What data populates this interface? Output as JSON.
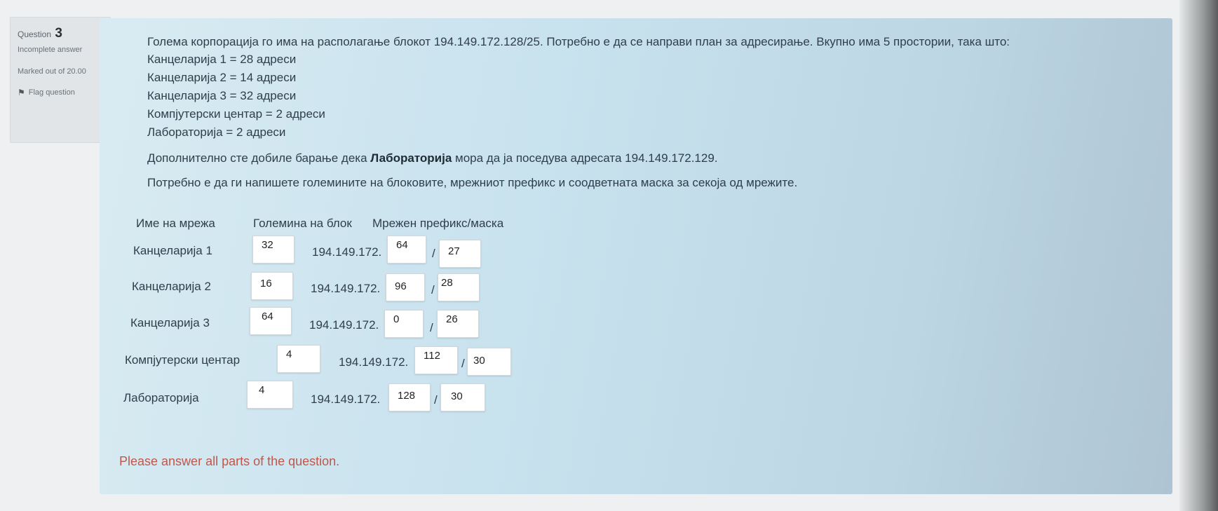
{
  "question": {
    "label": "Question",
    "number": "3",
    "state": "Incomplete answer",
    "grade": "Marked out of 20.00",
    "flag_label": "Flag question",
    "flag_icon": "flag-icon"
  },
  "text": {
    "intro": "Голема корпорација го има на располагање блокот 194.149.172.128/25. Потребно е да се направи план за адресирање. Вкупно има 5 простории, така што:",
    "requirements": [
      "Канцеларија 1 = 28 адреси",
      "Канцеларија 2 = 14 адреси",
      "Канцеларија 3 = 32 адреси",
      "Компјутерски центар = 2 адреси",
      "Лабораторија = 2 адреси"
    ],
    "extra_before": "Дополнително сте добиле барање дека ",
    "extra_bold": "Лабораторија",
    "extra_after": " мора да ја поседува адресата 194.149.172.129.",
    "instruction": "Потребно е да ги напишете големините на блоковите, мрежниот префикс и соодветната маска за секоја од мрежите."
  },
  "table": {
    "headers": {
      "network_name": "Име на мрежа",
      "block_size": "Големина на блок",
      "prefix_mask": "Мрежен префикс/маска"
    },
    "rows": [
      {
        "name": "Канцеларија 1",
        "size": "32",
        "prefix": "194.149.172.",
        "octet": "64",
        "mask": "27"
      },
      {
        "name": "Канцеларија 2",
        "size": "16",
        "prefix": "194.149.172.",
        "octet": "96",
        "mask": "28"
      },
      {
        "name": "Канцеларија 3",
        "size": "64",
        "prefix": "194.149.172.",
        "octet": "0",
        "mask": "26"
      },
      {
        "name": "Компјутерски центар",
        "size": "4",
        "prefix": "194.149.172.",
        "octet": "112",
        "mask": "30"
      },
      {
        "name": "Лабораторија",
        "size": "4",
        "prefix": "194.149.172.",
        "octet": "128",
        "mask": "30"
      }
    ],
    "separator": "/"
  },
  "validation_message": "Please answer all parts of the question.",
  "colors": {
    "panel": "#cfe6f0",
    "error_text": "#c1564a"
  }
}
